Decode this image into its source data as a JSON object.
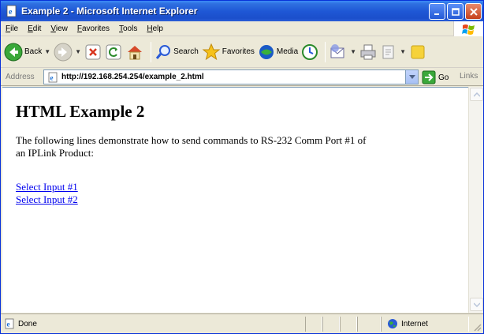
{
  "window": {
    "title": "Example 2 - Microsoft Internet Explorer"
  },
  "menu": {
    "items": [
      {
        "label": "File"
      },
      {
        "label": "Edit"
      },
      {
        "label": "View"
      },
      {
        "label": "Favorites"
      },
      {
        "label": "Tools"
      },
      {
        "label": "Help"
      }
    ]
  },
  "toolbar": {
    "back_label": "Back",
    "search_label": "Search",
    "favorites_label": "Favorites",
    "media_label": "Media"
  },
  "address": {
    "label": "Address",
    "url": "http://192.168.254.254/example_2.html",
    "go_label": "Go",
    "links_label": "Links"
  },
  "page": {
    "heading": "HTML Example 2",
    "paragraph": "The following lines demonstrate how to send commands to RS-232 Comm Port #1 of an IPLink Product:",
    "links": [
      {
        "label": "Select Input #1"
      },
      {
        "label": "Select Input #2"
      }
    ]
  },
  "status": {
    "text": "Done",
    "zone": "Internet"
  },
  "colors": {
    "titlebar": "#1f58d6",
    "chrome": "#ece9d8",
    "link": "#0000ee"
  }
}
